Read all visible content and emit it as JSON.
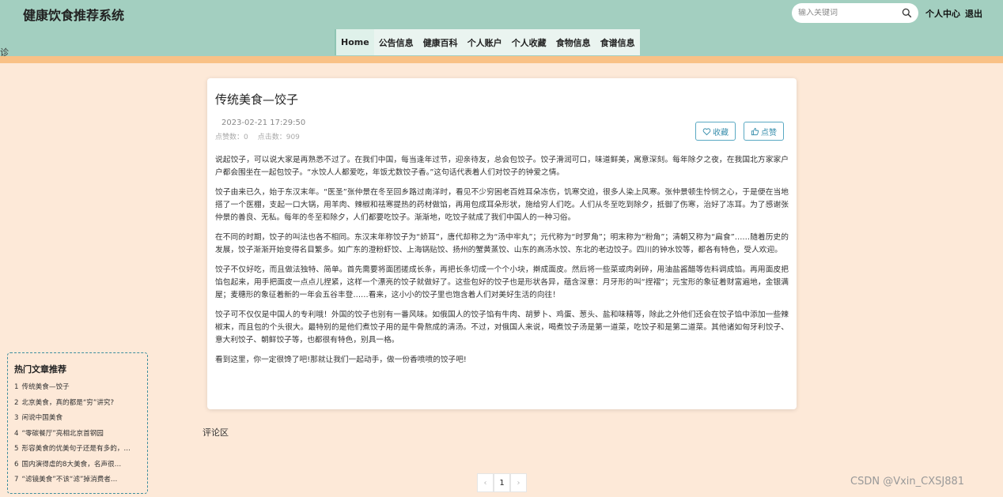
{
  "header": {
    "brand": "健康饮食推荐系统",
    "search_placeholder": "输入关键词",
    "personal_center": "个人中心",
    "logout": "退出",
    "stray_glyph": "诊"
  },
  "nav": {
    "items": [
      {
        "label": "Home",
        "active": true
      },
      {
        "label": "公告信息"
      },
      {
        "label": "健康百科"
      },
      {
        "label": "个人账户"
      },
      {
        "label": "个人收藏"
      },
      {
        "label": "食物信息"
      },
      {
        "label": "食谱信息"
      }
    ]
  },
  "article": {
    "title": "传统美食—饺子",
    "date": "2023-02-21 17:29:50",
    "likes_label": "点赞数：0",
    "clicks_label": "点击数：909",
    "favorite_label": "收藏",
    "like_label": "点赞",
    "paragraphs": [
      "说起饺子，可以说大家是再熟悉不过了。在我们中国，每当逢年过节，迎亲待友，总会包饺子。饺子滑润可口，味道鲜美，寓意深刻。每年除夕之夜，在我国北方家家户户都会围坐在一起包饺子。“水饺人人都爱吃，年饭尤数饺子香。”这句话代表着人们对饺子的钟爱之情。",
      "饺子由来已久，始于东汉末年。“医圣”张仲景在冬至回乡路过南洋时，看见不少穷困老百姓耳朵冻伤，饥寒交迫，很多人染上风寒。张仲景顿生怜悯之心，于是便在当地搭了一个医棚，支起一口大锅，用羊肉、辣椒和祛寒提热的药材做馅，再用包成耳朵形状，施给穷人们吃。人们从冬至吃到除夕，抵御了伤寒，治好了冻耳。为了感谢张仲景的善良、无私。每年的冬至和除夕，人们都要吃饺子。渐渐地，吃饺子就成了我们中国人的一种习俗。",
      "在不同的时期，饺子的叫法也各不相同。东汉末年称饺子为“娇耳”，唐代却称之为“汤中牢丸”；元代称为“时罗角”；明末称为“粉角”；清朝又称为“扁食”……随着历史的发展，饺子渐渐开始变得名目繁多。如广东的澄粉虾饺、上海锅贴饺、扬州的蟹黄蒸饺、山东的高汤水饺、东北的老边饺子。四川的钟水饺等，都各有特色，受人欢迎。",
      "饺子不仅好吃，而且做法独特、简单。首先需要将面团搓成长条，再把长条切成一个个小块，擀成面皮。然后将一些菜或肉剁碎，用油盐酱醋等佐料调成馅。再用面皮把馅包起来，用手把面皮一点点儿捏紧，这样一个漂亮的饺子就做好了。这些包好的饺子也是形状各异，蕴含深意：月牙形的叫“捏褶”；元宝形的象征着财富遍地，金银满屋；麦穗形的象征着新的一年会五谷丰登……看来，这小小的饺子里也饱含着人们对美好生活的向往！",
      "饺子可不仅仅是中国人的专利哦！外国的饺子也别有一番风味。如俄国人的饺子馅有牛肉、胡萝卜、鸡蛋、葱头、盐和味精等，除此之外他们还会在饺子馅中添加一些辣椒末，而且包的个头很大。最特别的是他们煮饺子用的是牛骨熬成的清汤。不过，对俄国人来说，喝煮饺子汤是第一道菜，吃饺子和是第二道菜。其他诸如匈牙利饺子、意大利饺子、朝鲜饺子等，也都很有特色，别具一格。",
      "看到这里，你一定很馋了吧!那就让我们一起动手，做一份香喷喷的饺子吧!"
    ]
  },
  "comments": {
    "label": "评论区"
  },
  "hot": {
    "title": "热门文章推荐",
    "items": [
      {
        "num": "1",
        "text": "传统美食—饺子"
      },
      {
        "num": "2",
        "text": "北京美食，真的都是“穷”讲究?"
      },
      {
        "num": "3",
        "text": "闲说中国美食"
      },
      {
        "num": "4",
        "text": "“零碳餐厅”亮相北京首钢园"
      },
      {
        "num": "5",
        "text": "形容美食的优美句子还是有多的，…"
      },
      {
        "num": "6",
        "text": "国内演得虐的8大美食，名声很…"
      },
      {
        "num": "7",
        "text": "“滤镜美食”不该“滤”掉消费者…"
      }
    ]
  },
  "pagination": {
    "prev": "‹",
    "current": "1",
    "next": "›"
  },
  "watermark": "CSDN @Vxin_CXSJ881",
  "colors": {
    "header": "#a3cfc0",
    "accent_bar": "#f9c186",
    "background": "#fde9d8",
    "button_border": "#5aa9c3"
  }
}
